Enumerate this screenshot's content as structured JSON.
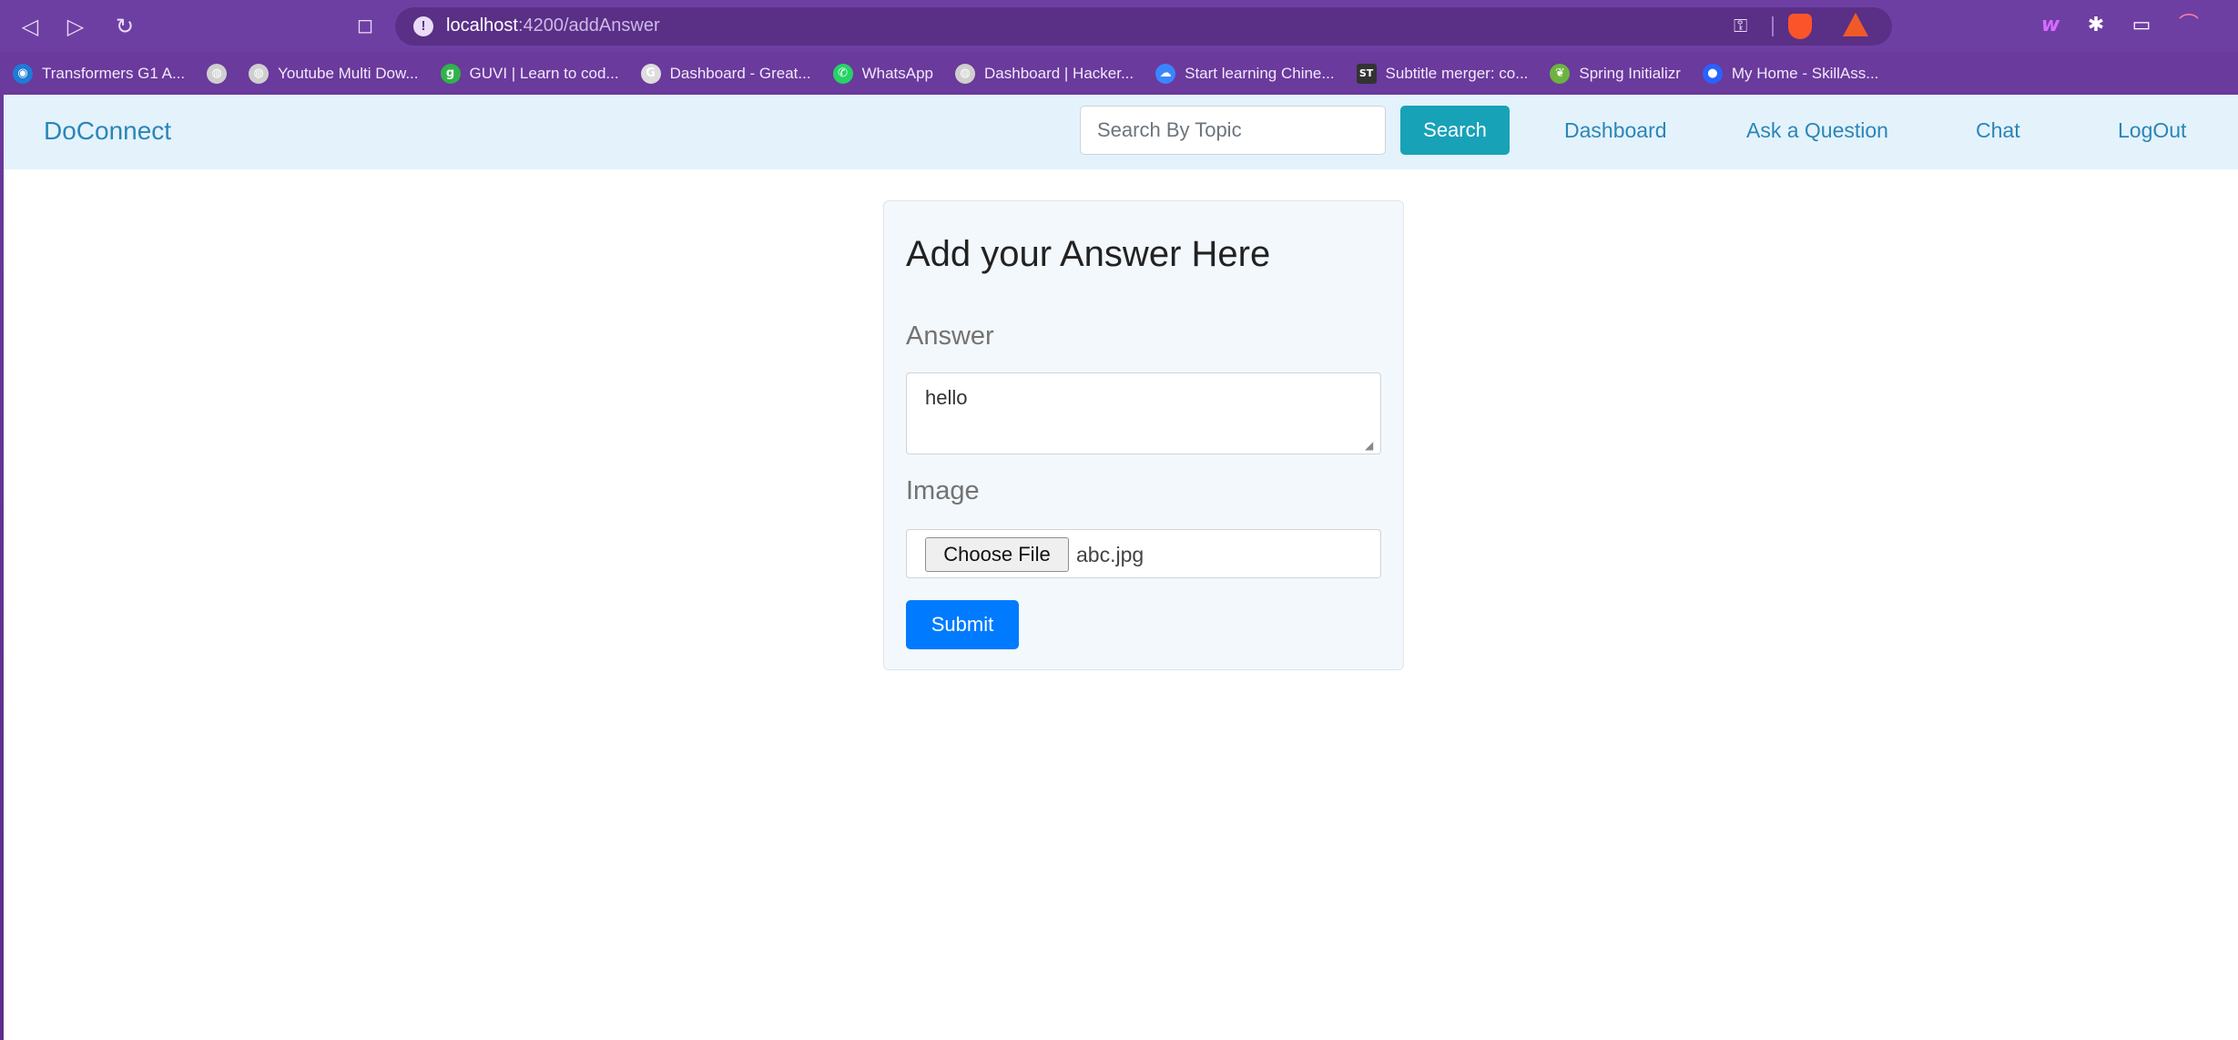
{
  "browser": {
    "url_host": "localhost",
    "url_path": ":4200/addAnswer",
    "back_icon": "back-icon",
    "forward_icon": "forward-icon",
    "reload_icon": "reload-icon",
    "bookmark_icon": "bookmark-icon",
    "bookmarks": [
      {
        "label": "Transformers G1 A...",
        "icon": "transformers-favicon",
        "color": "#1e7bd6"
      },
      {
        "label": "",
        "icon": "globe-favicon",
        "color": "#cfcfcf"
      },
      {
        "label": "Youtube Multi Dow...",
        "icon": "globe-favicon",
        "color": "#cfcfcf"
      },
      {
        "label": "GUVI | Learn to cod...",
        "icon": "guvi-favicon",
        "color": "#2fb34a"
      },
      {
        "label": "Dashboard - Great...",
        "icon": "greatlearning-favicon",
        "color": "#dddddd"
      },
      {
        "label": "WhatsApp",
        "icon": "whatsapp-favicon",
        "color": "#25d366"
      },
      {
        "label": "Dashboard | Hacker...",
        "icon": "globe-favicon",
        "color": "#cfcfcf"
      },
      {
        "label": "Start learning Chine...",
        "icon": "cloud-favicon",
        "color": "#3a86ff"
      },
      {
        "label": "Subtitle merger: co...",
        "icon": "st-favicon",
        "color": "#333333"
      },
      {
        "label": "Spring Initializr",
        "icon": "spring-favicon",
        "color": "#6db33f"
      },
      {
        "label": "My Home - SkillAss...",
        "icon": "skillassure-favicon",
        "color": "#2962ff"
      }
    ]
  },
  "app": {
    "brand": "DoConnect",
    "search": {
      "placeholder": "Search By Topic",
      "button": "Search"
    },
    "nav": {
      "dashboard": "Dashboard",
      "ask": "Ask a Question",
      "chat": "Chat",
      "logout": "LogOut"
    }
  },
  "form": {
    "title": "Add your Answer Here",
    "answer_label": "Answer",
    "answer_value": "hello",
    "image_label": "Image",
    "choose_file": "Choose File",
    "file_name": "abc.jpg",
    "submit": "Submit"
  },
  "colors": {
    "browser_chrome": "#6a3a9c",
    "app_nav_bg": "#e4f2fb",
    "brand_link": "#2a86b8",
    "search_button": "#17a2b8",
    "submit_button": "#007bff"
  }
}
